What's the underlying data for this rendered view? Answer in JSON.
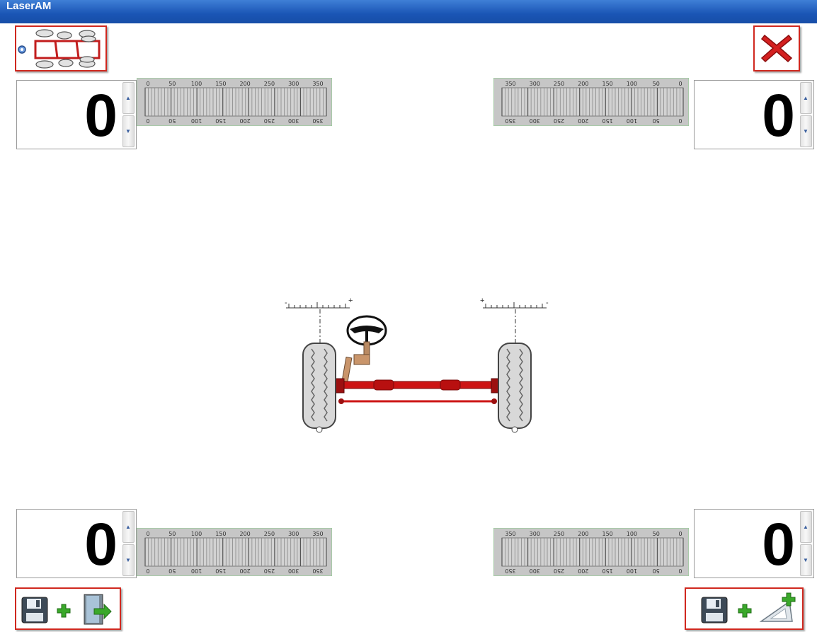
{
  "window": {
    "title": "LaserAM"
  },
  "icons": {
    "layout": "axle-layout-icon",
    "close": "close-x-icon",
    "save": "floppy-disk-icon",
    "plus": "plus-icon",
    "exit": "exit-door-icon",
    "measure": "triangle-ruler-icon"
  },
  "colors": {
    "title_bar": "#1a55b5",
    "button_border": "#d0281f",
    "axle": "#cc1414",
    "close_x": "#d42020",
    "plus": "#3aa82a"
  },
  "readouts": {
    "top_left": {
      "value": "0"
    },
    "top_right": {
      "value": "0"
    },
    "bottom_left": {
      "value": "0"
    },
    "bottom_right": {
      "value": "0"
    }
  },
  "ruler": {
    "ticks": [
      "0",
      "50",
      "100",
      "150",
      "200",
      "250",
      "300",
      "350"
    ]
  },
  "gauge": {
    "left_minus": "-",
    "left_plus": "+",
    "right_plus": "+",
    "right_minus": "-"
  }
}
